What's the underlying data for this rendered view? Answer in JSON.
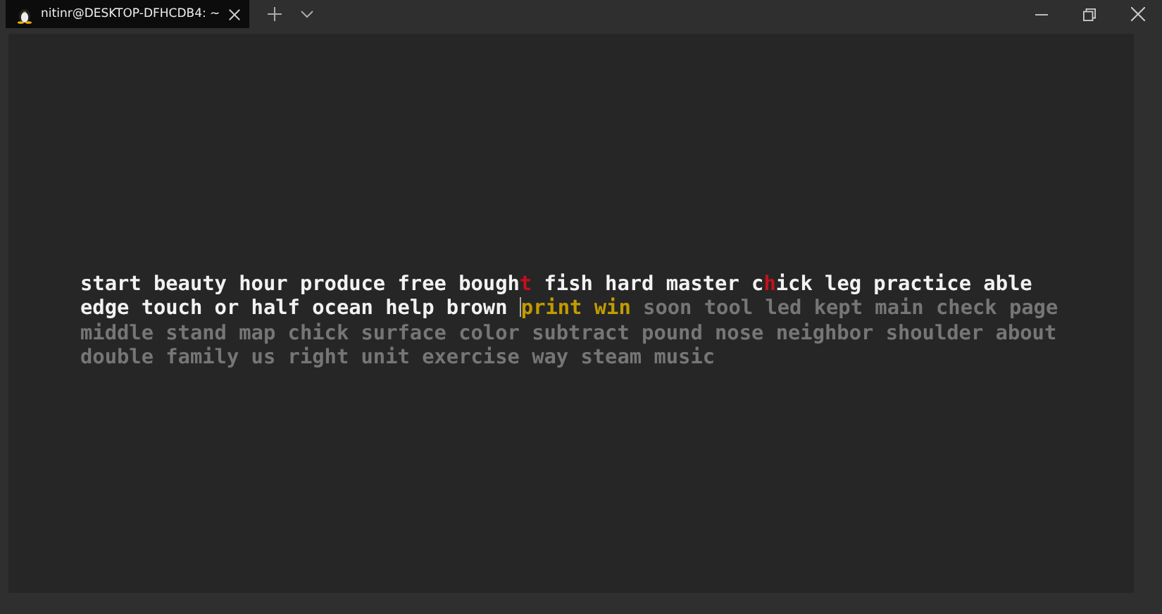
{
  "window": {
    "tab": {
      "title": "nitinr@DESKTOP-DFHCDB4: ~",
      "selected": true
    }
  },
  "terminal": {
    "lines": [
      [
        {
          "kind": "correct",
          "text": "start beauty hour produce free bough"
        },
        {
          "kind": "wrong",
          "text": "t"
        },
        {
          "kind": "correct",
          "text": " fish hard master c"
        },
        {
          "kind": "wrong",
          "text": "h"
        },
        {
          "kind": "correct",
          "text": "ick leg practice able"
        }
      ],
      [
        {
          "kind": "correct",
          "text": "edge touch or half ocean help brown "
        },
        {
          "kind": "cursor"
        },
        {
          "kind": "current",
          "text": "print win"
        },
        {
          "kind": "pending",
          "text": " soon tool led kept main check page"
        }
      ],
      [
        {
          "kind": "pending",
          "text": "middle stand map chick surface color subtract pound nose neighbor shoulder about"
        }
      ],
      [
        {
          "kind": "pending",
          "text": "double family us right unit exercise way steam music"
        }
      ]
    ]
  }
}
